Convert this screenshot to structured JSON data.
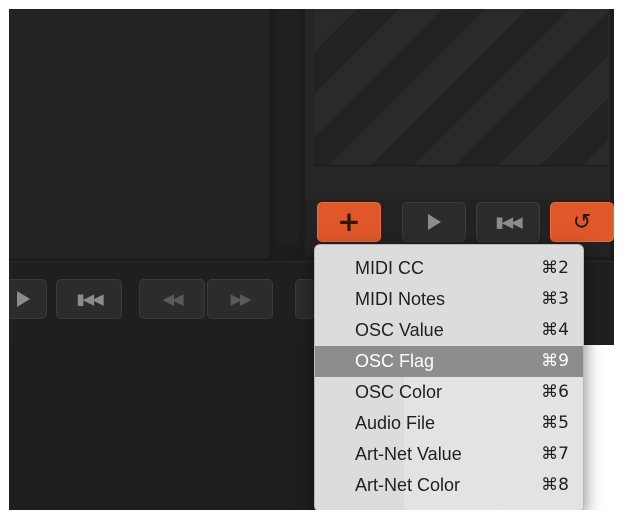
{
  "menu": {
    "items": [
      {
        "label": "MIDI CC",
        "shortcut": "⌘2"
      },
      {
        "label": "MIDI Notes",
        "shortcut": "⌘3"
      },
      {
        "label": "OSC Value",
        "shortcut": "⌘4"
      },
      {
        "label": "OSC Flag",
        "shortcut": "⌘9"
      },
      {
        "label": "OSC Color",
        "shortcut": "⌘6"
      },
      {
        "label": "Audio File",
        "shortcut": "⌘5"
      },
      {
        "label": "Art-Net Value",
        "shortcut": "⌘7"
      },
      {
        "label": "Art-Net Color",
        "shortcut": "⌘8"
      }
    ],
    "highlighted_item": "OSC Flag"
  },
  "toolbar_right": {
    "add_icon": "plus-icon",
    "play_icon": "play-icon",
    "rewind_icon": "skip-to-start-icon",
    "reset_icon": "reset-icon"
  },
  "transport_left": {
    "icons": [
      "play-icon",
      "skip-to-start-icon",
      "rewind-icon",
      "fast-forward-icon"
    ]
  },
  "colors": {
    "accent_orange": "#e0572a",
    "menu_bg": "#e2e2e2",
    "menu_highlight": "#8d8d8d",
    "app_bg": "#1c1c1c"
  }
}
